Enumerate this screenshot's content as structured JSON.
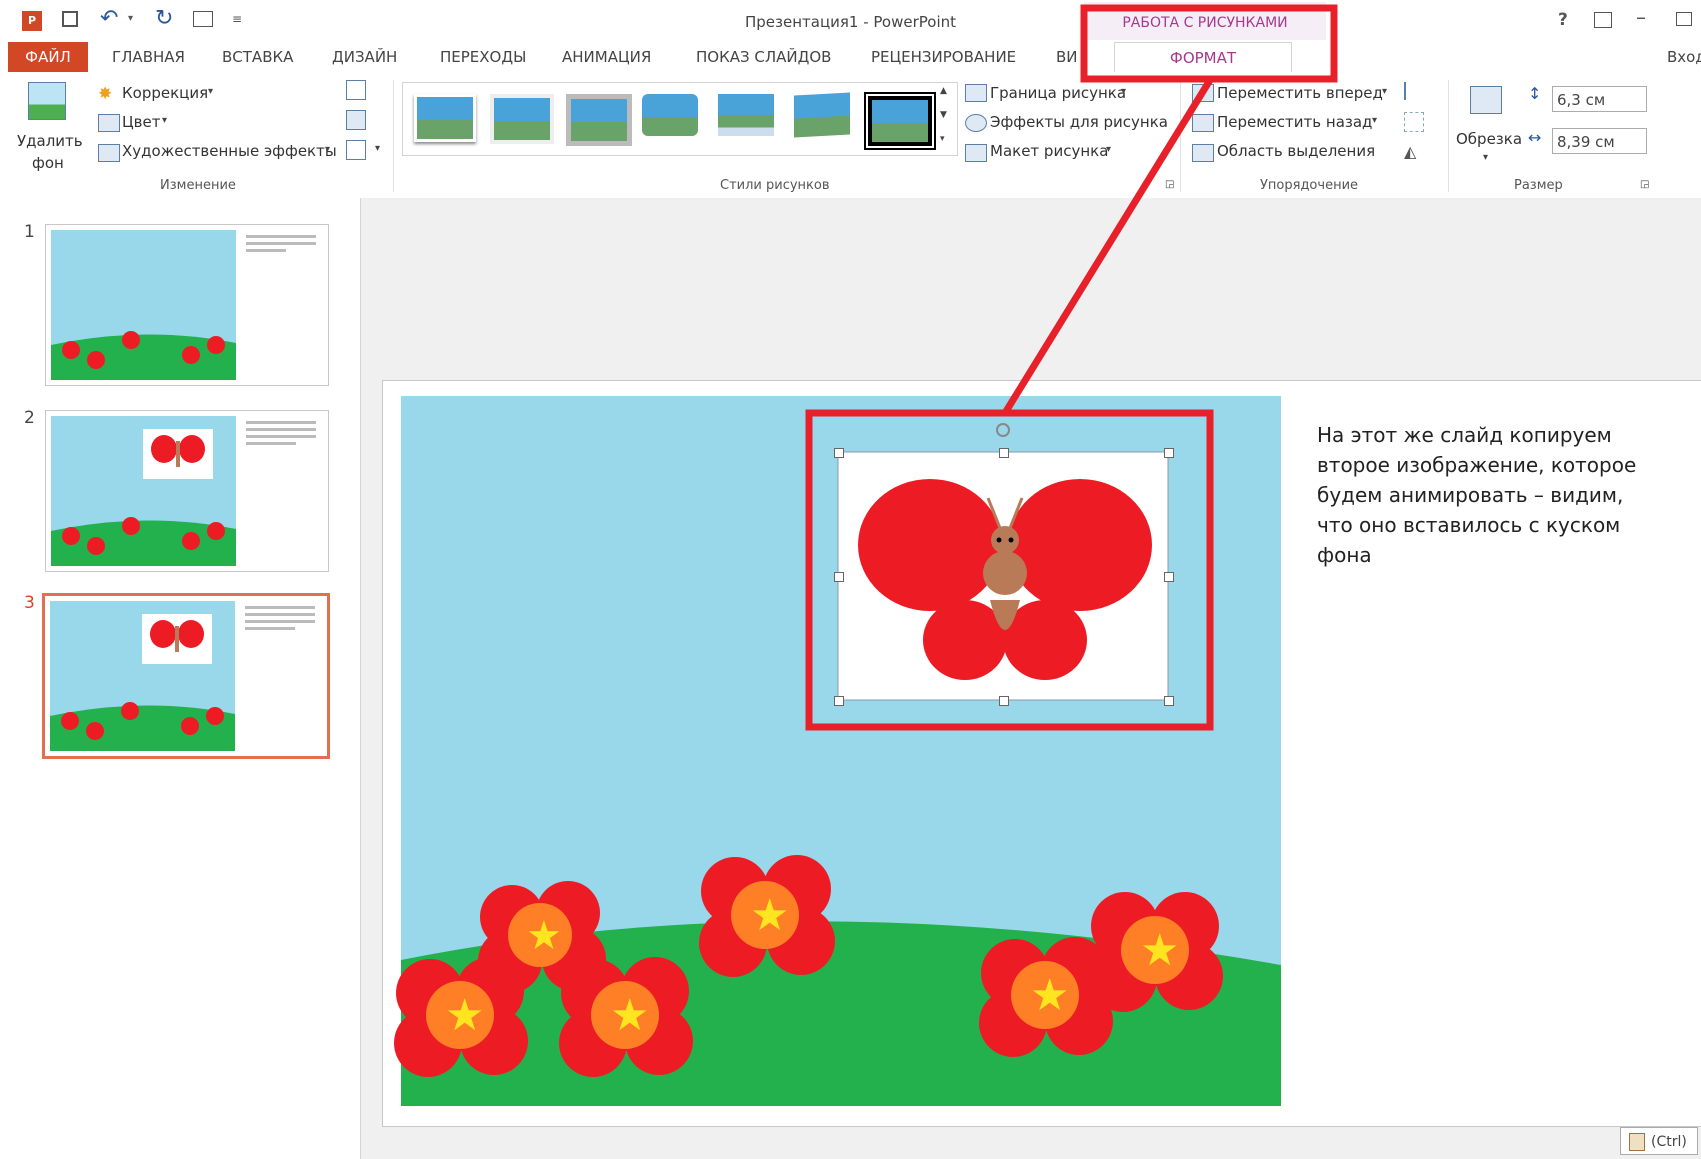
{
  "window": {
    "title": "Презентация1 - PowerPoint",
    "help": "?",
    "signin": "Вход"
  },
  "contextual_tab": {
    "group_title": "РАБОТА С РИСУНКАМИ",
    "tab_label": "ФОРМАТ"
  },
  "tabs": [
    "ФАЙЛ",
    "ГЛАВНАЯ",
    "ВСТАВКА",
    "ДИЗАЙН",
    "ПЕРЕХОДЫ",
    "АНИМАЦИЯ",
    "ПОКАЗ СЛАЙДОВ",
    "РЕЦЕНЗИРОВАНИЕ",
    "ВИ"
  ],
  "ribbon": {
    "remove_bg_line1": "Удалить",
    "remove_bg_line2": "фон",
    "correction": "Коррекция",
    "color": "Цвет",
    "artistic": "Художественные эффекты",
    "group_change": "Изменение",
    "group_styles": "Стили рисунков",
    "border": "Граница рисунка",
    "effects": "Эффекты для рисунка",
    "layout": "Макет рисунка",
    "bring_forward": "Переместить вперед",
    "send_backward": "Переместить назад",
    "selection_pane": "Область выделения",
    "group_arrange": "Упорядочение",
    "crop": "Обрезка",
    "height": "6,3 см",
    "width": "8,39 см",
    "group_size": "Размер"
  },
  "slides": {
    "numbers": [
      "1",
      "2",
      "3"
    ],
    "selected": 3
  },
  "slide_text": "На этот же слайд копируем второе изображение, которое будем анимировать – видим, что оно вставилось с куском фона",
  "paste_options": "(Ctrl)",
  "colors": {
    "accent": "#d24726",
    "annotation": "#e8202a",
    "sky": "#99d8ea",
    "grass": "#22b14c",
    "petal": "#ed1c24",
    "flower_center": "#ff7f27",
    "star": "#ffe51f",
    "butterfly_body": "#b97a57"
  }
}
